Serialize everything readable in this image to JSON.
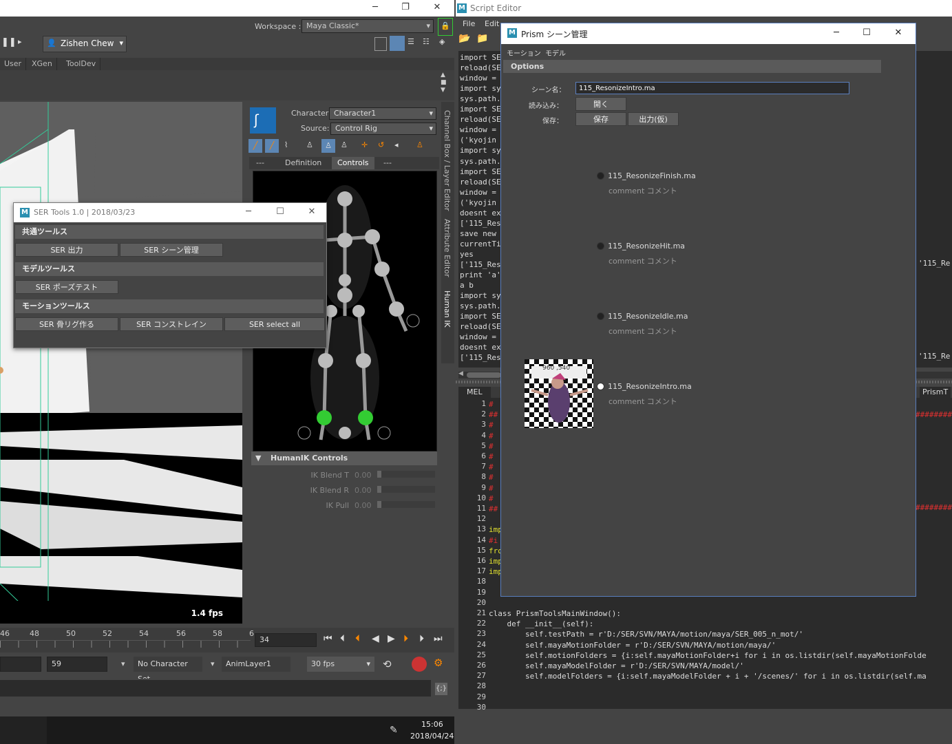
{
  "maya": {
    "workspace_label": "Workspace :",
    "workspace_value": "Maya Classic*",
    "user_name": "Zishen Chew",
    "shelf_tabs": [
      "User",
      "XGen",
      "ToolDev"
    ],
    "fps": "1.4 fps",
    "hik": {
      "character_label": "Character:",
      "character_value": "Character1",
      "source_label": "Source:",
      "source_value": "Control Rig",
      "tabs": [
        "---",
        "Definition",
        "Controls",
        "---"
      ],
      "controls_header": "HumanIK Controls",
      "sliders": [
        {
          "label": "IK Blend T",
          "value": "0.00"
        },
        {
          "label": "IK Blend R",
          "value": "0.00"
        },
        {
          "label": "IK Pull",
          "value": "0.00"
        }
      ]
    },
    "side_tabs": [
      "Channel Box / Layer Editor",
      "Attribute Editor",
      "Human IK"
    ],
    "timeline": {
      "ticks": [
        "46",
        "48",
        "50",
        "52",
        "54",
        "56",
        "58",
        "6"
      ],
      "current_frame": "34"
    },
    "range": {
      "end_frame": "59",
      "character_set": "No Character Set",
      "anim_layer": "AnimLayer1",
      "fps_option": "30 fps"
    },
    "clock": {
      "time": "15:06",
      "date": "2018/04/24"
    }
  },
  "ser_tools": {
    "title": "SER Tools 1.0 | 2018/03/23",
    "sections": [
      {
        "label": "共通ツールス",
        "buttons": [
          "SER 出力",
          "SER シーン管理"
        ]
      },
      {
        "label": "モデルツールス",
        "buttons": [
          "SER ポーズテスト"
        ]
      },
      {
        "label": "モーションツールス",
        "buttons": [
          "SER 骨リグ作る",
          "SER コンストレイン",
          "SER select all"
        ]
      }
    ]
  },
  "script_editor": {
    "title": "Script Editor",
    "menu": [
      "File",
      "Edit"
    ],
    "output_lines": [
      "import SE",
      "reload(SE",
      "window =",
      "import sy",
      "sys.path.",
      "import SE",
      "reload(SE",
      "window =",
      "('kyojin",
      "import sy",
      "sys.path.",
      "import SE",
      "reload(SE",
      "window =",
      "('kyojin",
      "doesnt ex",
      "['115_Res",
      "save new",
      "currentTi",
      "yes",
      "['115_Res",
      "print 'a'",
      "a b",
      "import sy",
      "sys.path.",
      "import SE",
      "reload(SE",
      "window =",
      "doesnt ex",
      "['115_Res"
    ],
    "output_right_1": "'115_Re",
    "output_right_2": "'115_Re",
    "tabs": [
      "MEL",
      "PrismT"
    ],
    "code_lines": [
      {
        "n": "1",
        "text": "#",
        "color": "#e03030"
      },
      {
        "n": "2",
        "text": "##",
        "color": "#e03030"
      },
      {
        "n": "3",
        "text": "#",
        "color": "#e03030"
      },
      {
        "n": "4",
        "text": "#",
        "color": "#e03030"
      },
      {
        "n": "5",
        "text": "#",
        "color": "#e03030"
      },
      {
        "n": "6",
        "text": "#",
        "color": "#e03030"
      },
      {
        "n": "7",
        "text": "#",
        "color": "#e03030"
      },
      {
        "n": "8",
        "text": "#",
        "color": "#e03030"
      },
      {
        "n": "9",
        "text": "#",
        "color": "#e03030"
      },
      {
        "n": "10",
        "text": "#",
        "color": "#e03030"
      },
      {
        "n": "11",
        "text": "##",
        "color": "#e03030"
      },
      {
        "n": "12",
        "text": "",
        "color": "#ddd"
      },
      {
        "n": "13",
        "text": "imp",
        "color": "#e0e030"
      },
      {
        "n": "14",
        "text": "#i",
        "color": "#e03030"
      },
      {
        "n": "15",
        "text": "fro",
        "color": "#e0e030"
      },
      {
        "n": "16",
        "text": "imp",
        "color": "#e0e030"
      },
      {
        "n": "17",
        "text": "imp",
        "color": "#e0e030"
      },
      {
        "n": "18",
        "text": "",
        "color": "#ddd"
      },
      {
        "n": "19",
        "text": "",
        "color": "#ddd"
      },
      {
        "n": "20",
        "text": "",
        "color": "#ddd"
      },
      {
        "n": "21",
        "text": "class PrismToolsMainWindow():",
        "color": "#ddd"
      },
      {
        "n": "22",
        "text": "    def __init__(self):",
        "color": "#ddd"
      },
      {
        "n": "23",
        "text": "        self.testPath = r'D:/SER/SVN/MAYA/motion/maya/SER_005_n_mot/'",
        "color": "#ddd"
      },
      {
        "n": "24",
        "text": "        self.mayaMotionFolder = r'D:/SER/SVN/MAYA/motion/maya/'",
        "color": "#ddd"
      },
      {
        "n": "25",
        "text": "        self.motionFolders = {i:self.mayaMotionFolder+i for i in os.listdir(self.mayaMotionFolde",
        "color": "#ddd"
      },
      {
        "n": "26",
        "text": "        self.mayaModelFolder = r'D:/SER/SVN/MAYA/model/'",
        "color": "#ddd"
      },
      {
        "n": "27",
        "text": "        self.modelFolders = {i:self.mayaModelFolder + i + '/scenes/' for i in os.listdir(self.ma",
        "color": "#ddd"
      },
      {
        "n": "28",
        "text": "",
        "color": "#ddd"
      },
      {
        "n": "29",
        "text": "",
        "color": "#ddd"
      },
      {
        "n": "30",
        "text": "",
        "color": "#ddd"
      }
    ],
    "hash_tail": "########"
  },
  "prism": {
    "title": "Prism シーン管理",
    "menu": [
      "モーション",
      "モデル"
    ],
    "options_header": "Options",
    "scene_name_label": "シーン名：",
    "scene_name_value": "115_ResonizeIntro.ma",
    "load_label": "読み込み：",
    "open_button": "開く",
    "save_label": "保存：",
    "save_button": "保存",
    "export_button": "出力(仮)",
    "thumb_label": "960 ,540",
    "scenes": [
      {
        "name": "115_ResonizeFinish.ma",
        "comment": "comment コメント"
      },
      {
        "name": "115_ResonizeHit.ma",
        "comment": "comment コメント"
      },
      {
        "name": "115_ResonizeIdle.ma",
        "comment": "comment コメント"
      },
      {
        "name": "115_ResonizeIntro.ma",
        "comment": "comment コメント"
      }
    ]
  }
}
